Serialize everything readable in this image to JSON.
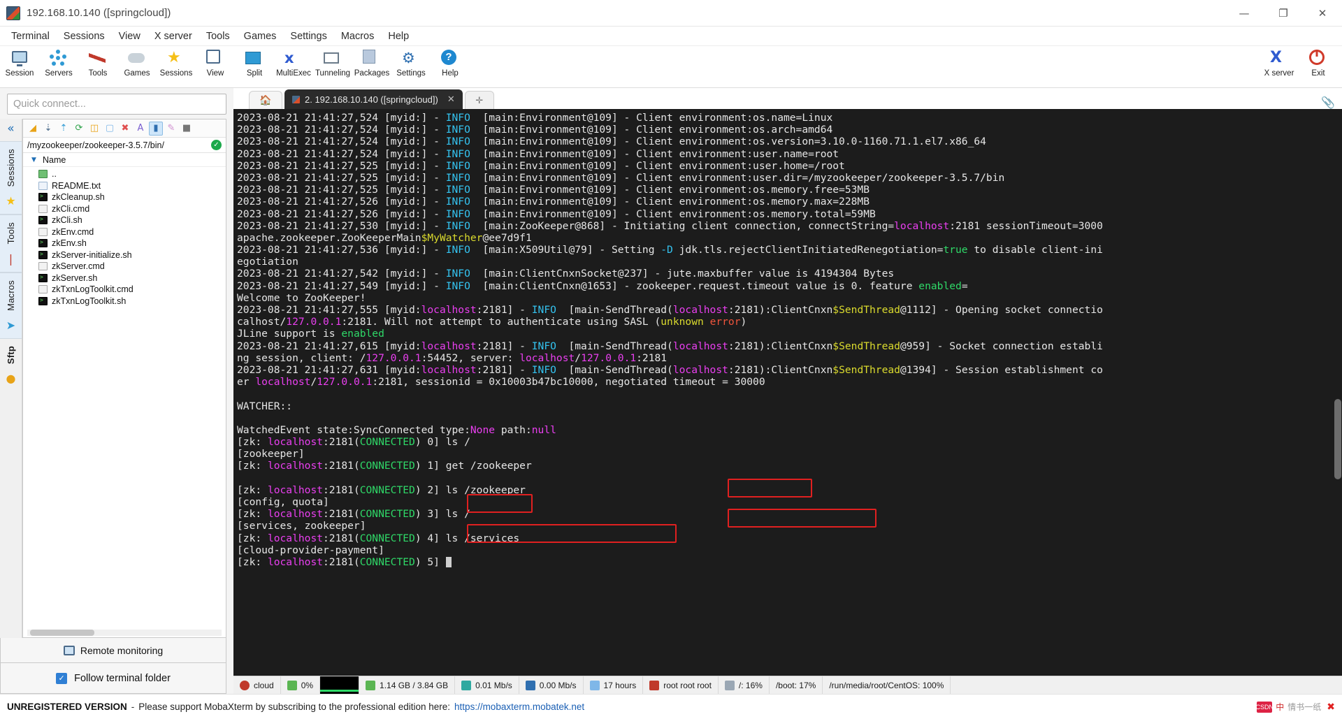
{
  "window": {
    "title": "192.168.10.140 ([springcloud])",
    "buttons": {
      "minimize": "—",
      "maximize": "❐",
      "close": "✕"
    }
  },
  "menubar": [
    "Terminal",
    "Sessions",
    "View",
    "X server",
    "Tools",
    "Games",
    "Settings",
    "Macros",
    "Help"
  ],
  "toolbar": {
    "left": [
      {
        "label": "Session",
        "icon": "session-icon"
      },
      {
        "label": "Servers",
        "icon": "servers-icon"
      },
      {
        "label": "Tools",
        "icon": "tools-icon"
      },
      {
        "label": "Games",
        "icon": "games-icon"
      },
      {
        "label": "Sessions",
        "icon": "sessions-star-icon"
      },
      {
        "label": "View",
        "icon": "view-icon"
      },
      {
        "label": "Split",
        "icon": "split-icon"
      },
      {
        "label": "MultiExec",
        "icon": "multiexec-icon"
      },
      {
        "label": "Tunneling",
        "icon": "tunneling-icon"
      },
      {
        "label": "Packages",
        "icon": "packages-icon"
      },
      {
        "label": "Settings",
        "icon": "settings-gear-icon"
      },
      {
        "label": "Help",
        "icon": "help-icon"
      }
    ],
    "right": [
      {
        "label": "X server",
        "icon": "x-server-icon"
      },
      {
        "label": "Exit",
        "icon": "power-icon"
      }
    ]
  },
  "sidebar": {
    "quick_connect_placeholder": "Quick connect...",
    "collapse_icon": "«",
    "vtabs": [
      "Sessions",
      "Tools",
      "Macros",
      "Sftp"
    ],
    "file_toolbar_icons": [
      "upload-folder-icon",
      "download-icon",
      "upload-icon",
      "refresh-icon",
      "new-folder-icon",
      "new-file-icon",
      "delete-icon",
      "text-mode-icon",
      "binary-mode-icon",
      "edit-icon",
      "terminal-icon"
    ],
    "path": "/myzookeeper/zookeeper-3.5.7/bin/",
    "path_status_icon": "check-icon",
    "column_header": "Name",
    "files": [
      {
        "name": "..",
        "type": "up"
      },
      {
        "name": "README.txt",
        "type": "txt"
      },
      {
        "name": "zkCleanup.sh",
        "type": "sh"
      },
      {
        "name": "zkCli.cmd",
        "type": "cmd"
      },
      {
        "name": "zkCli.sh",
        "type": "sh"
      },
      {
        "name": "zkEnv.cmd",
        "type": "cmd"
      },
      {
        "name": "zkEnv.sh",
        "type": "sh"
      },
      {
        "name": "zkServer-initialize.sh",
        "type": "sh"
      },
      {
        "name": "zkServer.cmd",
        "type": "cmd"
      },
      {
        "name": "zkServer.sh",
        "type": "sh"
      },
      {
        "name": "zkTxnLogToolkit.cmd",
        "type": "cmd"
      },
      {
        "name": "zkTxnLogToolkit.sh",
        "type": "sh"
      }
    ],
    "remote_monitoring": "Remote monitoring",
    "follow_terminal_folder": "Follow terminal folder",
    "follow_checked": true
  },
  "tabs": {
    "home_icon": "home-icon",
    "session_tab": "2. 192.168.10.140 ([springcloud])",
    "close_icon": "✕",
    "new_tab_icon": "✛",
    "clipboard_icon": "paperclip-icon"
  },
  "terminal": {
    "lines": [
      [
        {
          "t": "2023-08-21 21:41:27,524 [myid:] - ",
          "c": "w"
        },
        {
          "t": "INFO",
          "c": "i"
        },
        {
          "t": "  [main:Environment@109] - Client environment:os.name=Linux",
          "c": "w"
        }
      ],
      [
        {
          "t": "2023-08-21 21:41:27,524 [myid:] - ",
          "c": "w"
        },
        {
          "t": "INFO",
          "c": "i"
        },
        {
          "t": "  [main:Environment@109] - Client environment:os.arch=amd64",
          "c": "w"
        }
      ],
      [
        {
          "t": "2023-08-21 21:41:27,524 [myid:] - ",
          "c": "w"
        },
        {
          "t": "INFO",
          "c": "i"
        },
        {
          "t": "  [main:Environment@109] - Client environment:os.version=3.10.0-1160.71.1.el7.x86_64",
          "c": "w"
        }
      ],
      [
        {
          "t": "2023-08-21 21:41:27,524 [myid:] - ",
          "c": "w"
        },
        {
          "t": "INFO",
          "c": "i"
        },
        {
          "t": "  [main:Environment@109] - Client environment:user.name=root",
          "c": "w"
        }
      ],
      [
        {
          "t": "2023-08-21 21:41:27,525 [myid:] - ",
          "c": "w"
        },
        {
          "t": "INFO",
          "c": "i"
        },
        {
          "t": "  [main:Environment@109] - Client environment:user.home=/root",
          "c": "w"
        }
      ],
      [
        {
          "t": "2023-08-21 21:41:27,525 [myid:] - ",
          "c": "w"
        },
        {
          "t": "INFO",
          "c": "i"
        },
        {
          "t": "  [main:Environment@109] - Client environment:user.dir=/myzookeeper/zookeeper-3.5.7/bin",
          "c": "w"
        }
      ],
      [
        {
          "t": "2023-08-21 21:41:27,525 [myid:] - ",
          "c": "w"
        },
        {
          "t": "INFO",
          "c": "i"
        },
        {
          "t": "  [main:Environment@109] - Client environment:os.memory.free=53MB",
          "c": "w"
        }
      ],
      [
        {
          "t": "2023-08-21 21:41:27,526 [myid:] - ",
          "c": "w"
        },
        {
          "t": "INFO",
          "c": "i"
        },
        {
          "t": "  [main:Environment@109] - Client environment:os.memory.max=228MB",
          "c": "w"
        }
      ],
      [
        {
          "t": "2023-08-21 21:41:27,526 [myid:] - ",
          "c": "w"
        },
        {
          "t": "INFO",
          "c": "i"
        },
        {
          "t": "  [main:Environment@109] - Client environment:os.memory.total=59MB",
          "c": "w"
        }
      ],
      [
        {
          "t": "2023-08-21 21:41:27,530 [myid:] - ",
          "c": "w"
        },
        {
          "t": "INFO",
          "c": "i"
        },
        {
          "t": "  [main:ZooKeeper@868] - Initiating client connection, connectString=",
          "c": "w"
        },
        {
          "t": "localhost",
          "c": "m"
        },
        {
          "t": ":2181 sessionTimeout=3000",
          "c": "w"
        }
      ],
      [
        {
          "t": "apache.zookeeper.ZooKeeperMain",
          "c": "w"
        },
        {
          "t": "$MyWatcher",
          "c": "y"
        },
        {
          "t": "@ee7d9f1",
          "c": "w"
        }
      ],
      [
        {
          "t": "2023-08-21 21:41:27,536 [myid:] - ",
          "c": "w"
        },
        {
          "t": "INFO",
          "c": "i"
        },
        {
          "t": "  [main:X509Util@79] - Setting ",
          "c": "w"
        },
        {
          "t": "-D",
          "c": "i"
        },
        {
          "t": " jdk.tls.rejectClientInitiatedRenegotiation=",
          "c": "w"
        },
        {
          "t": "true",
          "c": "g"
        },
        {
          "t": " to disable client-ini",
          "c": "w"
        }
      ],
      [
        {
          "t": "egotiation",
          "c": "w"
        }
      ],
      [
        {
          "t": "2023-08-21 21:41:27,542 [myid:] - ",
          "c": "w"
        },
        {
          "t": "INFO",
          "c": "i"
        },
        {
          "t": "  [main:ClientCnxnSocket@237] - jute.maxbuffer value is 4194304 Bytes",
          "c": "w"
        }
      ],
      [
        {
          "t": "2023-08-21 21:41:27,549 [myid:] - ",
          "c": "w"
        },
        {
          "t": "INFO",
          "c": "i"
        },
        {
          "t": "  [main:ClientCnxn@1653] - zookeeper.request.timeout value is 0. feature ",
          "c": "w"
        },
        {
          "t": "enabled",
          "c": "g"
        },
        {
          "t": "=",
          "c": "w"
        }
      ],
      [
        {
          "t": "Welcome to ZooKeeper!",
          "c": "w"
        }
      ],
      [
        {
          "t": "2023-08-21 21:41:27,555 [myid:",
          "c": "w"
        },
        {
          "t": "localhost",
          "c": "m"
        },
        {
          "t": ":2181] - ",
          "c": "w"
        },
        {
          "t": "INFO",
          "c": "i"
        },
        {
          "t": "  [main-SendThread(",
          "c": "w"
        },
        {
          "t": "localhost",
          "c": "m"
        },
        {
          "t": ":2181):ClientCnxn",
          "c": "w"
        },
        {
          "t": "$SendThread",
          "c": "y"
        },
        {
          "t": "@1112] - Opening socket connectio",
          "c": "w"
        }
      ],
      [
        {
          "t": "calhost/",
          "c": "w"
        },
        {
          "t": "127.0.0.1",
          "c": "m"
        },
        {
          "t": ":2181. Will not attempt to authenticate using SASL (",
          "c": "w"
        },
        {
          "t": "unknown",
          "c": "y"
        },
        {
          "t": " ",
          "c": "w"
        },
        {
          "t": "error",
          "c": "r"
        },
        {
          "t": ")",
          "c": "w"
        }
      ],
      [
        {
          "t": "JLine support is ",
          "c": "w"
        },
        {
          "t": "enabled",
          "c": "g"
        }
      ],
      [
        {
          "t": "2023-08-21 21:41:27,615 [myid:",
          "c": "w"
        },
        {
          "t": "localhost",
          "c": "m"
        },
        {
          "t": ":2181] - ",
          "c": "w"
        },
        {
          "t": "INFO",
          "c": "i"
        },
        {
          "t": "  [main-SendThread(",
          "c": "w"
        },
        {
          "t": "localhost",
          "c": "m"
        },
        {
          "t": ":2181):ClientCnxn",
          "c": "w"
        },
        {
          "t": "$SendThread",
          "c": "y"
        },
        {
          "t": "@959] - Socket connection establi",
          "c": "w"
        }
      ],
      [
        {
          "t": "ng session, client: /",
          "c": "w"
        },
        {
          "t": "127.0.0.1",
          "c": "m"
        },
        {
          "t": ":54452, server: ",
          "c": "w"
        },
        {
          "t": "localhost",
          "c": "m"
        },
        {
          "t": "/",
          "c": "w"
        },
        {
          "t": "127.0.0.1",
          "c": "m"
        },
        {
          "t": ":2181",
          "c": "w"
        }
      ],
      [
        {
          "t": "2023-08-21 21:41:27,631 [myid:",
          "c": "w"
        },
        {
          "t": "localhost",
          "c": "m"
        },
        {
          "t": ":2181] - ",
          "c": "w"
        },
        {
          "t": "INFO",
          "c": "i"
        },
        {
          "t": "  [main-SendThread(",
          "c": "w"
        },
        {
          "t": "localhost",
          "c": "m"
        },
        {
          "t": ":2181):ClientCnxn",
          "c": "w"
        },
        {
          "t": "$SendThread",
          "c": "y"
        },
        {
          "t": "@1394] - Session establishment co",
          "c": "w"
        }
      ],
      [
        {
          "t": "er ",
          "c": "w"
        },
        {
          "t": "localhost",
          "c": "m"
        },
        {
          "t": "/",
          "c": "w"
        },
        {
          "t": "127.0.0.1",
          "c": "m"
        },
        {
          "t": ":2181, sessionid = 0x10003b47bc10000, negotiated timeout = 30000",
          "c": "w"
        }
      ],
      [
        {
          "t": "",
          "c": "w"
        }
      ],
      [
        {
          "t": "WATCHER::",
          "c": "w"
        }
      ],
      [
        {
          "t": "",
          "c": "w"
        }
      ],
      [
        {
          "t": "WatchedEvent state:SyncConnected type:",
          "c": "w"
        },
        {
          "t": "None",
          "c": "m"
        },
        {
          "t": " path:",
          "c": "w"
        },
        {
          "t": "null",
          "c": "m"
        }
      ],
      [
        {
          "t": "[zk: ",
          "c": "w"
        },
        {
          "t": "localhost",
          "c": "m"
        },
        {
          "t": ":2181(",
          "c": "w"
        },
        {
          "t": "CONNECTED",
          "c": "g"
        },
        {
          "t": ") 0] ls /",
          "c": "w"
        }
      ],
      [
        {
          "t": "[zookeeper]",
          "c": "w"
        }
      ],
      [
        {
          "t": "[zk: ",
          "c": "w"
        },
        {
          "t": "localhost",
          "c": "m"
        },
        {
          "t": ":2181(",
          "c": "w"
        },
        {
          "t": "CONNECTED",
          "c": "g"
        },
        {
          "t": ") 1] get /zookeeper",
          "c": "w"
        }
      ],
      [
        {
          "t": "",
          "c": "w"
        }
      ],
      [
        {
          "t": "[zk: ",
          "c": "w"
        },
        {
          "t": "localhost",
          "c": "m"
        },
        {
          "t": ":2181(",
          "c": "w"
        },
        {
          "t": "CONNECTED",
          "c": "g"
        },
        {
          "t": ") 2] ls /zookeeper",
          "c": "w"
        }
      ],
      [
        {
          "t": "[config, quota]",
          "c": "w"
        }
      ],
      [
        {
          "t": "[zk: ",
          "c": "w"
        },
        {
          "t": "localhost",
          "c": "m"
        },
        {
          "t": ":2181(",
          "c": "w"
        },
        {
          "t": "CONNECTED",
          "c": "g"
        },
        {
          "t": ") 3] ls /",
          "c": "w"
        }
      ],
      [
        {
          "t": "[services, zookeeper]",
          "c": "w"
        }
      ],
      [
        {
          "t": "[zk: ",
          "c": "w"
        },
        {
          "t": "localhost",
          "c": "m"
        },
        {
          "t": ":2181(",
          "c": "w"
        },
        {
          "t": "CONNECTED",
          "c": "g"
        },
        {
          "t": ") 4] ls /services",
          "c": "w"
        }
      ],
      [
        {
          "t": "[cloud-provider-payment]",
          "c": "w"
        }
      ],
      [
        {
          "t": "[zk: ",
          "c": "w"
        },
        {
          "t": "localhost",
          "c": "m"
        },
        {
          "t": ":2181(",
          "c": "w"
        },
        {
          "t": "CONNECTED",
          "c": "g"
        },
        {
          "t": ") 5] ",
          "c": "w"
        }
      ]
    ],
    "annotation_color": "#e02020"
  },
  "statusbar": {
    "items": [
      {
        "label": "cloud",
        "icon": "host-icon"
      },
      {
        "label": "0%",
        "icon": "cpu-icon"
      },
      {
        "label": "",
        "icon": "graph-icon"
      },
      {
        "label": "1.14 GB / 3.84 GB",
        "icon": "memory-icon"
      },
      {
        "label": "0.01 Mb/s",
        "icon": "upload-arrow-icon"
      },
      {
        "label": "0.00 Mb/s",
        "icon": "download-arrow-icon"
      },
      {
        "label": "17 hours",
        "icon": "uptime-icon"
      },
      {
        "label": "root  root  root",
        "icon": "users-icon"
      },
      {
        "label": "/: 16%",
        "icon": "disk-icon"
      },
      {
        "label": "/boot: 17%",
        "icon": ""
      },
      {
        "label": "/run/media/root/CentOS: 100%",
        "icon": ""
      }
    ]
  },
  "footer": {
    "unregistered": "UNREGISTERED VERSION",
    "dash": "-",
    "message": "Please support MobaXterm by subscribing to the professional edition here:",
    "link": "https://mobaxterm.mobatek.net",
    "watermark": "情书一纸",
    "csdn": "CSDN",
    "lang": "中"
  }
}
